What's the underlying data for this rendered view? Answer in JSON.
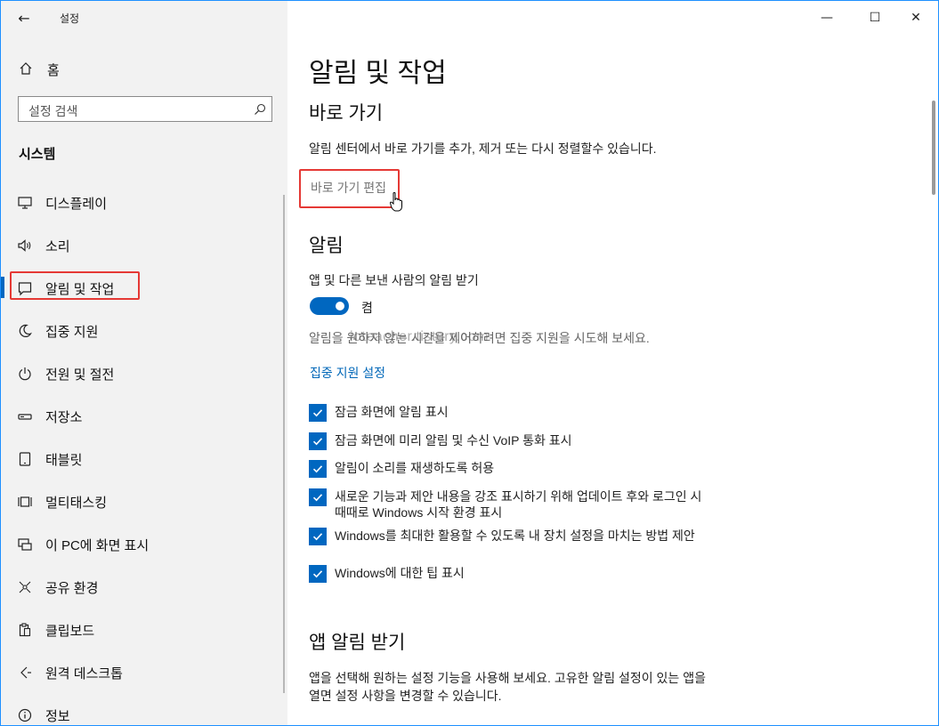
{
  "window": {
    "app_title": "설정",
    "back_glyph": "←",
    "minimize_glyph": "—",
    "maximize_glyph": "☐",
    "close_glyph": "✕",
    "border_color": "#1e90ff"
  },
  "sidebar": {
    "background": "#f2f2f2",
    "home_label": "홈",
    "home_icon": "home-icon",
    "search": {
      "placeholder": "설정 검색",
      "icon": "search-icon"
    },
    "section_title": "시스템",
    "items": [
      {
        "label": "디스플레이",
        "icon": "monitor-icon",
        "selected": false
      },
      {
        "label": "소리",
        "icon": "speaker-icon",
        "selected": false
      },
      {
        "label": "알림 및 작업",
        "icon": "notification-icon",
        "selected": true
      },
      {
        "label": "집중 지원",
        "icon": "moon-icon",
        "selected": false
      },
      {
        "label": "전원 및 절전",
        "icon": "power-icon",
        "selected": false
      },
      {
        "label": "저장소",
        "icon": "storage-icon",
        "selected": false
      },
      {
        "label": "태블릿",
        "icon": "tablet-icon",
        "selected": false
      },
      {
        "label": "멀티태스킹",
        "icon": "multitasking-icon",
        "selected": false
      },
      {
        "label": "이 PC에 화면 표시",
        "icon": "project-icon",
        "selected": false
      },
      {
        "label": "공유 환경",
        "icon": "share-icon",
        "selected": false
      },
      {
        "label": "클립보드",
        "icon": "clipboard-icon",
        "selected": false
      },
      {
        "label": "원격 데스크톱",
        "icon": "remote-desktop-icon",
        "selected": false
      },
      {
        "label": "정보",
        "icon": "info-icon",
        "selected": false
      }
    ]
  },
  "main": {
    "title": "알림 및 작업",
    "shortcuts": {
      "heading": "바로 가기",
      "description": "알림 센터에서 바로 가기를 추가, 제거 또는 다시 정렬할수 있습니다.",
      "link": "바로 가기 편집"
    },
    "notifications": {
      "heading": "알림",
      "toggle_label": "앱 및 다른 보낸 사람의 알림 받기",
      "toggle_on": true,
      "toggle_state_text": "켬",
      "focus_description": "알림을 원하지 않는 시간을 제어하려면 집중 지원을 시도해 보세요.",
      "focus_link": "집중 지원 설정",
      "checkboxes": [
        {
          "label": "잠금 화면에 알림 표시",
          "checked": true
        },
        {
          "label": "잠금 화면에 미리 알림 및 수신 VoIP 통화 표시",
          "checked": true
        },
        {
          "label": "알림이 소리를 재생하도록 허용",
          "checked": true
        },
        {
          "label": "새로운 기능과 제안 내용을 강조 표시하기 위해 업데이트 후와 로그인 시 때때로 Windows 시작 환경 표시",
          "checked": true
        },
        {
          "label": "Windows를 최대한 활용할 수 있도록 내 장치 설정을 마치는 방법 제안",
          "checked": true
        },
        {
          "label": "Windows에 대한 팁 표시",
          "checked": true
        }
      ]
    },
    "app_notifications": {
      "heading": "앱 알림 받기",
      "description": "앱을 선택해 원하는 설정 기능을 사용해 보세요. 고유한 알림 설정이 있는 앱을 열면 설정 사항을 변경할 수 있습니다."
    }
  },
  "watermark": "ioteacher.tistory.com",
  "cursor": "hand-cursor-icon",
  "colors": {
    "accent": "#0067c0",
    "link": "#0067b8",
    "annotation": "#e53935",
    "main_background": "#ffffff"
  }
}
